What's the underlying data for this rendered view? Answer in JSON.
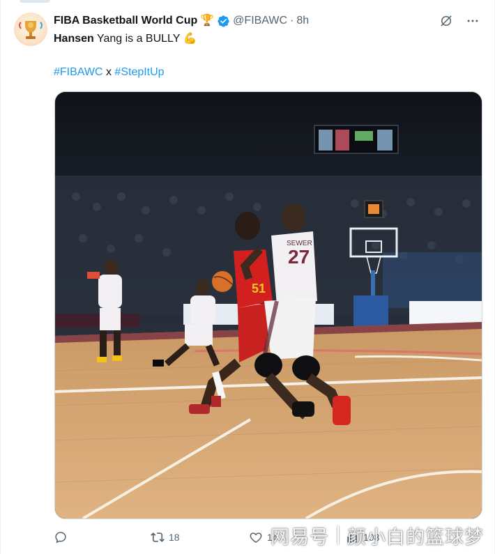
{
  "tweet": {
    "display_name": "FIBA Basketball World Cup",
    "name_emoji": "🏆",
    "handle": "@FIBAWC",
    "separator": "·",
    "time": "8h",
    "text_bold": "Hansen",
    "text_rest": " Yang is a BULLY",
    "text_emoji": "💪",
    "hashtag_1": "#FIBAWC",
    "joiner": " x ",
    "hashtag_2": "#StepItUp"
  },
  "media": {
    "jersey_number_white": "27",
    "jersey_number_red": "51",
    "jersey_name_white": "SEWER"
  },
  "actions": {
    "reply_count": "",
    "retweet_count": "18",
    "like_count": "14",
    "views_count": "108"
  },
  "watermark": {
    "left": "网易号",
    "right": "颜小白的篮球梦"
  },
  "icons": [
    "verified-badge-icon",
    "grok-icon",
    "more-icon",
    "reply-icon",
    "retweet-icon",
    "like-icon",
    "views-icon"
  ],
  "colors": {
    "accent": "#1d9bf0",
    "muted": "#536471",
    "text": "#0f1419"
  }
}
